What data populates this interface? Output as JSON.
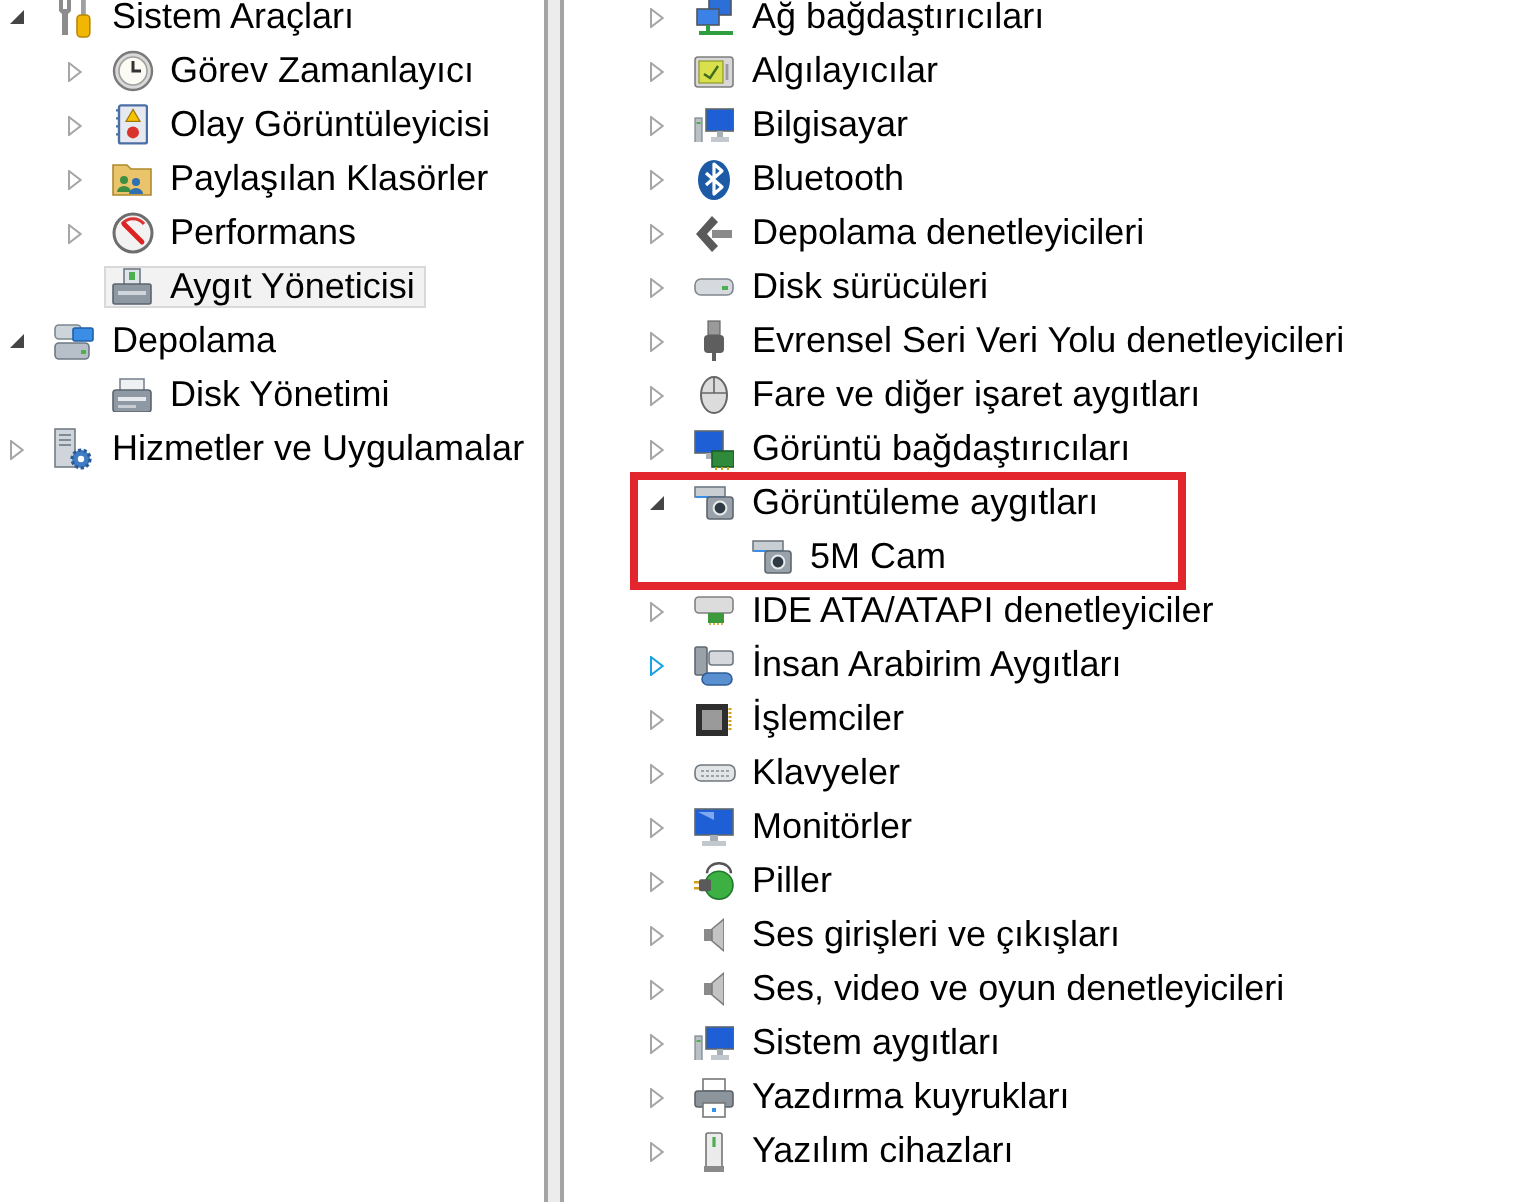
{
  "navigation_tree": {
    "items": [
      {
        "label": "Sistem Araçları",
        "expanded": true,
        "selected": false,
        "children": [
          {
            "label": "Görev Zamanlayıcı",
            "expanded": false,
            "selected": false
          },
          {
            "label": "Olay Görüntüleyicisi",
            "expanded": false,
            "selected": false
          },
          {
            "label": "Paylaşılan Klasörler",
            "expanded": false,
            "selected": false
          },
          {
            "label": "Performans",
            "expanded": false,
            "selected": false
          },
          {
            "label": "Aygıt Yöneticisi",
            "selected": true
          }
        ]
      },
      {
        "label": "Depolama",
        "expanded": true,
        "selected": false,
        "children": [
          {
            "label": "Disk Yönetimi",
            "selected": false
          }
        ]
      },
      {
        "label": "Hizmetler ve Uygulamalar",
        "expanded": false,
        "selected": false
      }
    ]
  },
  "device_tree": {
    "items": [
      {
        "label": "Ağ bağdaştırıcıları",
        "expanded": false,
        "hovered": false,
        "highlighted": false
      },
      {
        "label": "Algılayıcılar",
        "expanded": false,
        "hovered": false,
        "highlighted": false
      },
      {
        "label": "Bilgisayar",
        "expanded": false,
        "hovered": false,
        "highlighted": false
      },
      {
        "label": "Bluetooth",
        "expanded": false,
        "hovered": false,
        "highlighted": false
      },
      {
        "label": "Depolama denetleyicileri",
        "expanded": false,
        "hovered": false,
        "highlighted": false
      },
      {
        "label": "Disk sürücüleri",
        "expanded": false,
        "hovered": false,
        "highlighted": false
      },
      {
        "label": "Evrensel Seri Veri Yolu denetleyicileri",
        "expanded": false,
        "hovered": false,
        "highlighted": false
      },
      {
        "label": "Fare ve diğer işaret aygıtları",
        "expanded": false,
        "hovered": false,
        "highlighted": false
      },
      {
        "label": "Görüntü bağdaştırıcıları",
        "expanded": false,
        "hovered": false,
        "highlighted": false
      },
      {
        "label": "Görüntüleme aygıtları",
        "expanded": true,
        "hovered": false,
        "highlighted": true,
        "children": [
          {
            "label": "5M Cam",
            "highlighted": false
          }
        ]
      },
      {
        "label": "IDE ATA/ATAPI denetleyiciler",
        "expanded": false,
        "hovered": false,
        "highlighted": false
      },
      {
        "label": "İnsan Arabirim Aygıtları",
        "expanded": false,
        "hovered": true,
        "highlighted": false
      },
      {
        "label": "İşlemciler",
        "expanded": false,
        "hovered": false,
        "highlighted": false
      },
      {
        "label": "Klavyeler",
        "expanded": false,
        "hovered": false,
        "highlighted": false
      },
      {
        "label": "Monitörler",
        "expanded": false,
        "hovered": false,
        "highlighted": false
      },
      {
        "label": "Piller",
        "expanded": false,
        "hovered": false,
        "highlighted": false
      },
      {
        "label": "Ses girişleri ve çıkışları",
        "expanded": false,
        "hovered": false,
        "highlighted": false
      },
      {
        "label": "Ses, video ve oyun denetleyicileri",
        "expanded": false,
        "hovered": false,
        "highlighted": false
      },
      {
        "label": "Sistem aygıtları",
        "expanded": false,
        "hovered": false,
        "highlighted": false
      },
      {
        "label": "Yazdırma kuyrukları",
        "expanded": false,
        "hovered": false,
        "highlighted": false
      },
      {
        "label": "Yazılım cihazları",
        "expanded": false,
        "hovered": false,
        "highlighted": false
      }
    ]
  }
}
